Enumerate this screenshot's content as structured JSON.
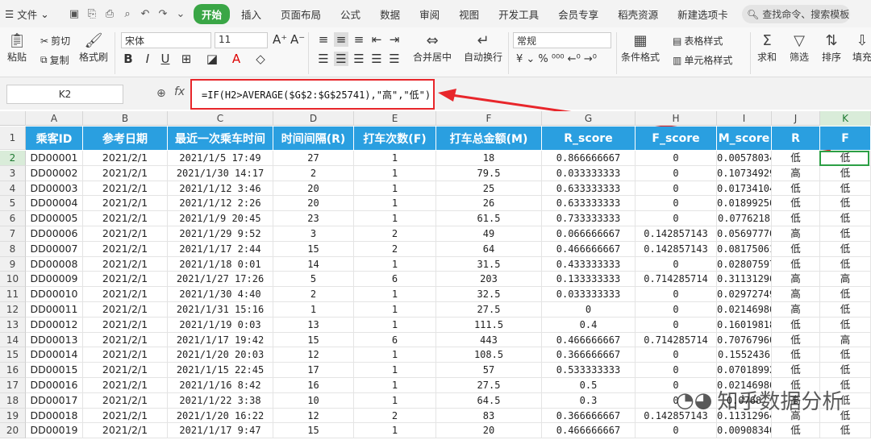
{
  "menubar": {
    "file": "文件",
    "tabs": [
      "开始",
      "插入",
      "页面布局",
      "公式",
      "数据",
      "审阅",
      "视图",
      "开发工具",
      "会员专享",
      "稻壳资源",
      "新建选项卡"
    ],
    "search": "查找命令、搜索模板"
  },
  "ribbon": {
    "paste": "粘贴",
    "cut": "剪切",
    "copy": "复制",
    "format_painter": "格式刷",
    "font": "宋体",
    "size": "11",
    "merge": "合并居中",
    "wrap": "自动换行",
    "numfmt": "常规",
    "cond": "条件格式",
    "table_style": "表格样式",
    "cell_style": "单元格样式",
    "sum": "求和",
    "filter": "筛选",
    "sort": "排序",
    "fill": "填充"
  },
  "formula_bar": {
    "cell": "K2",
    "fx": "fx",
    "formula": "=IF(H2>AVERAGE($G$2:$G$25741),\"高\",\"低\")"
  },
  "columns": [
    "A",
    "B",
    "C",
    "D",
    "E",
    "F",
    "G",
    "H",
    "I",
    "J",
    "K"
  ],
  "headers": [
    "乘客ID",
    "参考日期",
    "最近一次乘车时间",
    "时间间隔(R)",
    "打车次数(F)",
    "打车总金额(M)",
    "R_score",
    "F_score",
    "M_score",
    "R",
    "F"
  ],
  "rows": [
    [
      "DD00001",
      "2021/2/1",
      "2021/1/5 17:49",
      "27",
      "1",
      "18",
      "0.866666667",
      "0",
      "0.005780347",
      "低",
      "低"
    ],
    [
      "DD00002",
      "2021/2/1",
      "2021/1/30 14:17",
      "2",
      "1",
      "79.5",
      "0.033333333",
      "0",
      "0.107349298",
      "高",
      "低"
    ],
    [
      "DD00003",
      "2021/2/1",
      "2021/1/12 3:46",
      "20",
      "1",
      "25",
      "0.633333333",
      "0",
      "0.01734104",
      "低",
      "低"
    ],
    [
      "DD00004",
      "2021/2/1",
      "2021/1/12 2:26",
      "20",
      "1",
      "26",
      "0.633333333",
      "0",
      "0.018992568",
      "低",
      "低"
    ],
    [
      "DD00005",
      "2021/2/1",
      "2021/1/9 20:45",
      "23",
      "1",
      "61.5",
      "0.733333333",
      "0",
      "0.0776218",
      "低",
      "低"
    ],
    [
      "DD00006",
      "2021/2/1",
      "2021/1/29 9:52",
      "3",
      "2",
      "49",
      "0.066666667",
      "0.142857143",
      "0.056977704",
      "高",
      "低"
    ],
    [
      "DD00007",
      "2021/2/1",
      "2021/1/17 2:44",
      "15",
      "2",
      "64",
      "0.466666667",
      "0.142857143",
      "0.081750619",
      "低",
      "低"
    ],
    [
      "DD00008",
      "2021/2/1",
      "2021/1/18 0:01",
      "14",
      "1",
      "31.5",
      "0.433333333",
      "0",
      "0.02807597",
      "低",
      "低"
    ],
    [
      "DD00009",
      "2021/2/1",
      "2021/1/27 17:26",
      "5",
      "6",
      "203",
      "0.133333333",
      "0.714285714",
      "0.311312964",
      "高",
      "高"
    ],
    [
      "DD00010",
      "2021/2/1",
      "2021/1/30 4:40",
      "2",
      "1",
      "32.5",
      "0.033333333",
      "0",
      "0.029727498",
      "高",
      "低"
    ],
    [
      "DD00011",
      "2021/2/1",
      "2021/1/31 15:16",
      "1",
      "1",
      "27.5",
      "0",
      "0",
      "0.02146986",
      "高",
      "低"
    ],
    [
      "DD00012",
      "2021/2/1",
      "2021/1/19 0:03",
      "13",
      "1",
      "111.5",
      "0.4",
      "0",
      "0.160198183",
      "低",
      "低"
    ],
    [
      "DD00013",
      "2021/2/1",
      "2021/1/17 19:42",
      "15",
      "6",
      "443",
      "0.466666667",
      "0.714285714",
      "0.707679604",
      "低",
      "高"
    ],
    [
      "DD00014",
      "2021/2/1",
      "2021/1/20 20:03",
      "12",
      "1",
      "108.5",
      "0.366666667",
      "0",
      "0.1552436",
      "低",
      "低"
    ],
    [
      "DD00015",
      "2021/2/1",
      "2021/1/15 22:45",
      "17",
      "1",
      "57",
      "0.533333333",
      "0",
      "0.070189926",
      "低",
      "低"
    ],
    [
      "DD00016",
      "2021/2/1",
      "2021/1/16 8:42",
      "16",
      "1",
      "27.5",
      "0.5",
      "0",
      "0.02146986",
      "低",
      "低"
    ],
    [
      "DD00017",
      "2021/2/1",
      "2021/1/22 3:38",
      "10",
      "1",
      "64.5",
      "0.3",
      "0",
      "0.0768",
      "高",
      "低"
    ],
    [
      "DD00018",
      "2021/2/1",
      "2021/1/20 16:22",
      "12",
      "2",
      "83",
      "0.366666667",
      "0.142857143",
      "0.113129645",
      "高",
      "低"
    ],
    [
      "DD00019",
      "2021/2/1",
      "2021/1/17 9:47",
      "15",
      "1",
      "20",
      "0.466666667",
      "0",
      "0.009083402",
      "低",
      "低"
    ]
  ],
  "watermark": "知乎数据分析",
  "accent": "#2a9fe0"
}
